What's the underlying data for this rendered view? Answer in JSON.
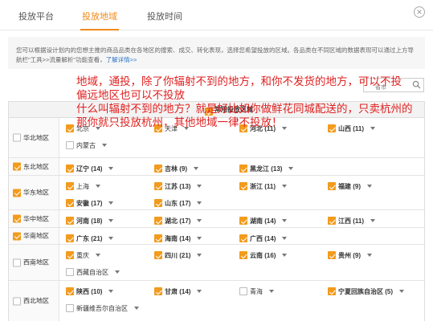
{
  "tabs": [
    {
      "label": "投放平台"
    },
    {
      "label": "投放地域"
    },
    {
      "label": "投放时间"
    }
  ],
  "close_symbol": "✕",
  "description": {
    "text_part1": "您可以根据设计划内的您想主推的商品品类在各地区的搜索、成交、转化表现，选择您希望投放的区域。各品类在不同区域的数据表现可以通过上方导航栏\"工具>>流量解析\"功能查看，",
    "link": "了解详情>>"
  },
  "search": {
    "placeholder": "省市"
  },
  "header": {
    "label": "常用投放区域"
  },
  "annotation": {
    "line1": "地域，通投，除了你辐射不到的地方，和你不发货的地方，可以不投",
    "line2": "偏远地区也可以不投放",
    "line3": "什么叫辐射不到的地方？就是好比如你做鲜花同城配送的，只卖杭州的",
    "line4": "那你就只投放杭州，其他地域一律不投放！"
  },
  "regions": [
    {
      "name": "华北地区",
      "checked": false,
      "provinces": [
        {
          "name": "北京",
          "checked": true
        },
        {
          "name": "天津",
          "checked": true
        },
        {
          "name": "河北 (11)",
          "checked": true
        },
        {
          "name": "山西 (11)",
          "checked": true
        },
        {
          "name": "内蒙古",
          "checked": false
        }
      ]
    },
    {
      "name": "东北地区",
      "checked": true,
      "provinces": [
        {
          "name": "辽宁 (14)",
          "checked": true
        },
        {
          "name": "吉林 (9)",
          "checked": true
        },
        {
          "name": "黑龙江 (13)",
          "checked": true
        }
      ]
    },
    {
      "name": "华东地区",
      "checked": true,
      "provinces": [
        {
          "name": "上海",
          "checked": true
        },
        {
          "name": "江苏 (13)",
          "checked": true
        },
        {
          "name": "浙江 (11)",
          "checked": true
        },
        {
          "name": "福建 (9)",
          "checked": true
        },
        {
          "name": "安徽 (17)",
          "checked": true
        },
        {
          "name": "山东 (17)",
          "checked": true
        }
      ]
    },
    {
      "name": "华中地区",
      "checked": true,
      "provinces": [
        {
          "name": "河南 (18)",
          "checked": true
        },
        {
          "name": "湖北 (17)",
          "checked": true
        },
        {
          "name": "湖南 (14)",
          "checked": true
        },
        {
          "name": "江西 (11)",
          "checked": true
        }
      ]
    },
    {
      "name": "华南地区",
      "checked": true,
      "provinces": [
        {
          "name": "广东 (21)",
          "checked": true
        },
        {
          "name": "海南 (14)",
          "checked": true
        },
        {
          "name": "广西 (14)",
          "checked": true
        }
      ]
    },
    {
      "name": "西南地区",
      "checked": false,
      "provinces": [
        {
          "name": "重庆",
          "checked": true
        },
        {
          "name": "四川 (21)",
          "checked": true
        },
        {
          "name": "云南 (16)",
          "checked": true
        },
        {
          "name": "贵州 (9)",
          "checked": true
        },
        {
          "name": "西藏自治区",
          "checked": false
        }
      ]
    },
    {
      "name": "西北地区",
      "checked": false,
      "provinces": [
        {
          "name": "陕西 (10)",
          "checked": true
        },
        {
          "name": "甘肃 (14)",
          "checked": true
        },
        {
          "name": "青海",
          "checked": false
        },
        {
          "name": "宁夏回族自治区 (5)",
          "checked": true
        },
        {
          "name": "新疆维吾尔自治区",
          "checked": false
        }
      ]
    }
  ]
}
